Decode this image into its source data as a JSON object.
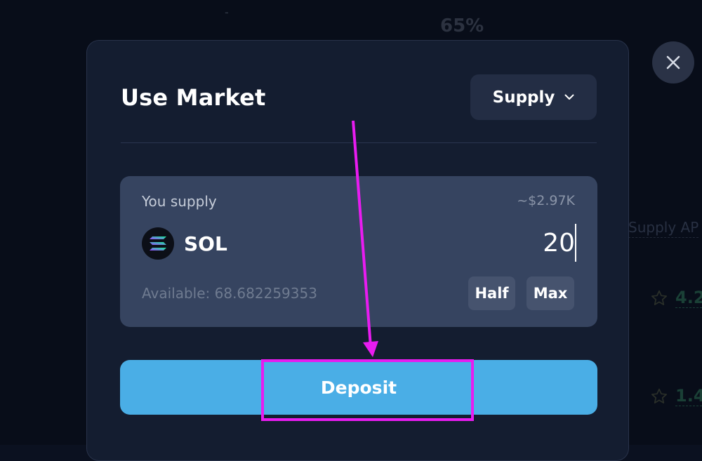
{
  "background": {
    "dash": "-",
    "percent": "65%",
    "column_header": "Supply AP",
    "rows": [
      {
        "value": "4.2"
      },
      {
        "value": "1.4"
      }
    ]
  },
  "modal": {
    "title": "Use Market",
    "mode_select": {
      "selected": "Supply"
    },
    "supply_card": {
      "label": "You supply",
      "usd_estimate": "~$2.97K",
      "token_symbol": "SOL",
      "amount_value": "20",
      "available": "Available: 68.682259353",
      "half_label": "Half",
      "max_label": "Max"
    },
    "deposit_label": "Deposit"
  },
  "icons": {
    "close": "close-icon",
    "chevron": "chevron-down-icon",
    "token": "solana-logo-icon",
    "star": "star-icon"
  },
  "colors": {
    "page_bg": "#0b1120",
    "modal_bg": "#141d30",
    "card_bg": "#364460",
    "deposit_button": "#4aaee6",
    "annotation": "#e81cf0",
    "positive_green": "#2c6e55"
  }
}
